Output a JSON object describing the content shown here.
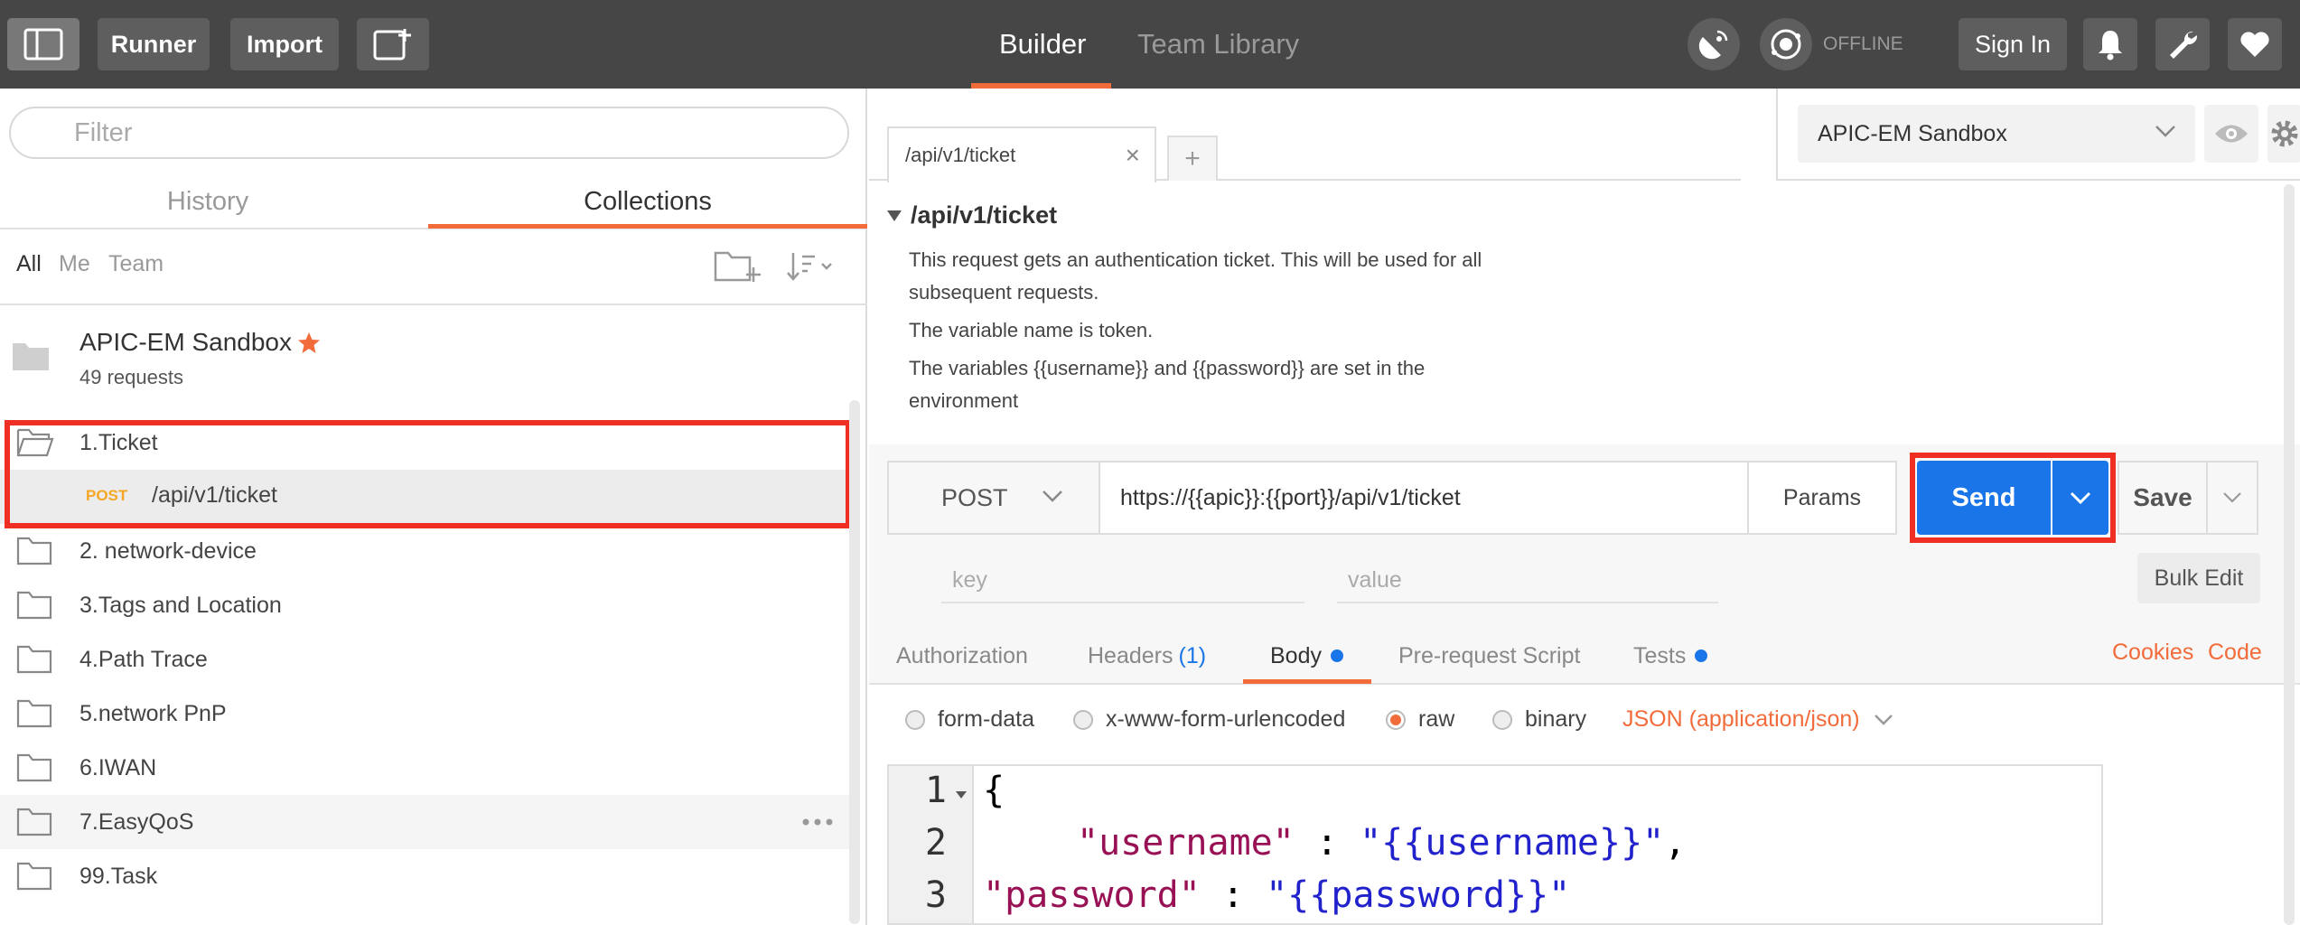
{
  "topbar": {
    "runner_label": "Runner",
    "import_label": "Import",
    "tabs": [
      {
        "label": "Builder"
      },
      {
        "label": "Team Library"
      }
    ],
    "status": "OFFLINE",
    "signin_label": "Sign In"
  },
  "sidebar": {
    "filter_placeholder": "Filter",
    "tabs": [
      {
        "label": "History"
      },
      {
        "label": "Collections"
      }
    ],
    "segments": [
      {
        "label": "All"
      },
      {
        "label": "Me"
      },
      {
        "label": "Team"
      }
    ],
    "collection": {
      "name": "APIC-EM Sandbox",
      "count": "49 requests"
    },
    "folders": [
      {
        "label": "1.Ticket"
      },
      {
        "label": "2. network-device"
      },
      {
        "label": "3.Tags and Location"
      },
      {
        "label": "4.Path Trace"
      },
      {
        "label": "5.network PnP"
      },
      {
        "label": "6.IWAN"
      },
      {
        "label": "7.EasyQoS"
      },
      {
        "label": "99.Task"
      }
    ],
    "request": {
      "method": "POST",
      "path": "/api/v1/ticket"
    }
  },
  "main": {
    "tab_label": "/api/v1/ticket",
    "environment": "APIC-EM Sandbox",
    "desc_title": "/api/v1/ticket",
    "desc_lines": [
      "This request gets an authentication ticket. This will be used for all subsequent requests.",
      "The variable name is token.",
      "The variables {{username}} and {{password}} are set in the environment"
    ],
    "method": "POST",
    "url": "https://{{apic}}:{{port}}/api/v1/ticket",
    "params_label": "Params",
    "send_label": "Send",
    "save_label": "Save",
    "key_placeholder": "key",
    "value_placeholder": "value",
    "bulk_edit_label": "Bulk Edit",
    "subtabs": [
      {
        "label": "Authorization"
      },
      {
        "label": "Headers",
        "count": "(1)"
      },
      {
        "label": "Body"
      },
      {
        "label": "Pre-request Script"
      },
      {
        "label": "Tests"
      }
    ],
    "cookies_label": "Cookies",
    "code_label": "Code",
    "body_modes": [
      {
        "label": "form-data"
      },
      {
        "label": "x-www-form-urlencoded"
      },
      {
        "label": "raw"
      },
      {
        "label": "binary"
      }
    ],
    "content_type": "JSON (application/json)",
    "code_lines": [
      {
        "n": "1",
        "text": "{"
      },
      {
        "n": "2",
        "key": "\"username\"",
        "sep": " : ",
        "val": "\"{{username}}\"",
        "tail": ","
      },
      {
        "n": "3",
        "key": "\"password\"",
        "sep": " : ",
        "val": "\"{{password}}\"",
        "tail": ""
      }
    ]
  },
  "colors": {
    "accent": "#f26b3a",
    "send": "#1a76e8",
    "highlight": "#ef2f24"
  }
}
